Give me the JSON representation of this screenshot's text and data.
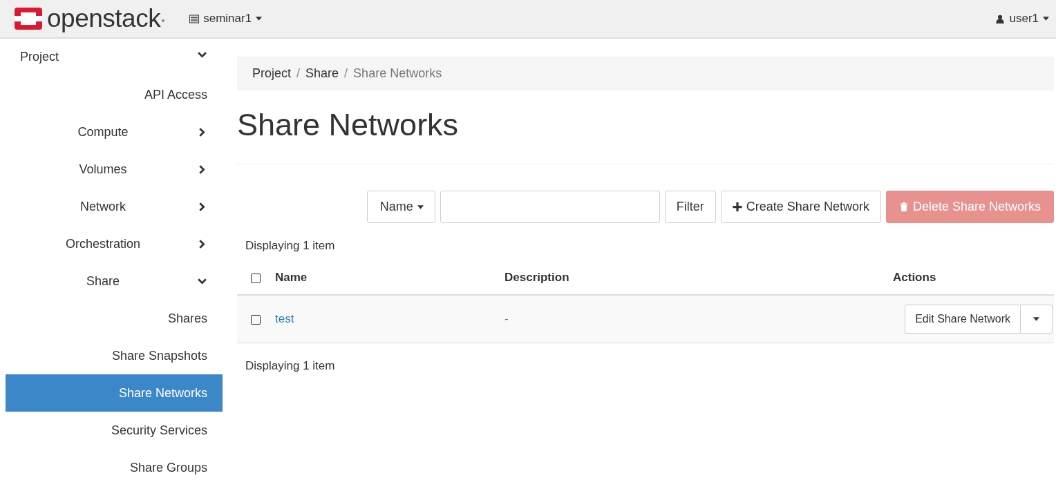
{
  "brand": {
    "name": "openstack"
  },
  "project_menu": {
    "label": "seminar1"
  },
  "user_menu": {
    "label": "user1"
  },
  "sidebar": {
    "items": [
      {
        "kind": "group",
        "label": "Project",
        "expanded": true,
        "children": [
          {
            "kind": "link",
            "label": "API Access",
            "selected": false
          },
          {
            "kind": "group",
            "label": "Compute",
            "expanded": false
          },
          {
            "kind": "group",
            "label": "Volumes",
            "expanded": false
          },
          {
            "kind": "group",
            "label": "Network",
            "expanded": false
          },
          {
            "kind": "group",
            "label": "Orchestration",
            "expanded": false
          },
          {
            "kind": "group",
            "label": "Share",
            "expanded": true,
            "children": [
              {
                "kind": "link",
                "label": "Shares",
                "selected": false
              },
              {
                "kind": "link",
                "label": "Share Snapshots",
                "selected": false
              },
              {
                "kind": "link",
                "label": "Share Networks",
                "selected": true
              },
              {
                "kind": "link",
                "label": "Security Services",
                "selected": false
              },
              {
                "kind": "link",
                "label": "Share Groups",
                "selected": false
              }
            ]
          }
        ]
      }
    ]
  },
  "breadcrumb": {
    "separator": "/",
    "items": [
      "Project",
      "Share",
      "Share Networks"
    ]
  },
  "page_title": "Share Networks",
  "toolbar": {
    "filter_select": "Name",
    "filter_button": "Filter",
    "create_button": "Create Share Network",
    "delete_button": {
      "label": "Delete Share Networks",
      "disabled": true
    }
  },
  "table": {
    "count_top": "Displaying 1 item",
    "count_bottom": "Displaying 1 item",
    "select_all": {
      "checked": false
    },
    "columns": [
      "Name",
      "Description",
      "Actions"
    ],
    "rows": [
      {
        "checked": false,
        "name": "test",
        "description": "-",
        "action": "Edit Share Network"
      }
    ]
  }
}
